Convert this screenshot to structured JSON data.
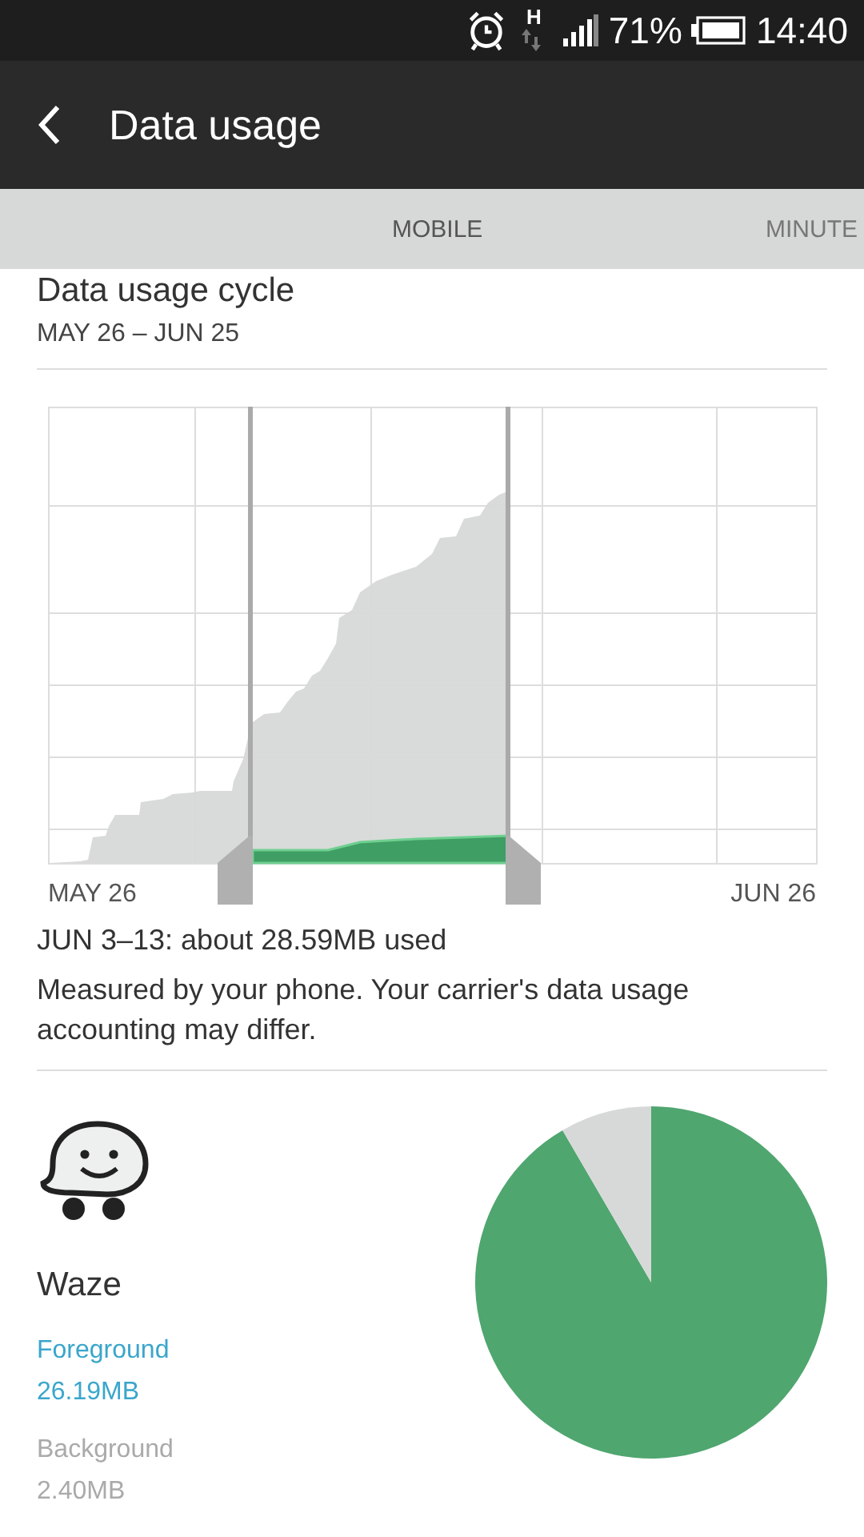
{
  "status_bar": {
    "network": "H",
    "battery": "71%",
    "time": "14:40"
  },
  "app_bar": {
    "title": "Data usage"
  },
  "tabs": [
    {
      "label": "MOBILE",
      "selected": true
    },
    {
      "label": "MINUTE",
      "selected": false
    }
  ],
  "cycle": {
    "title": "Data usage cycle",
    "range": "MAY 26 – JUN 25"
  },
  "usage_chart": {
    "start_label": "MAY 26",
    "end_label": "JUN 26"
  },
  "summary": {
    "usage": "JUN 3–13: about 28.59MB used",
    "note": "Measured by your phone. Your carrier's data usage accounting may differ."
  },
  "app": {
    "name": "Waze",
    "foreground_label": "Foreground",
    "foreground_value": "26.19MB",
    "background_label": "Background",
    "background_value": "2.40MB",
    "chart_data": {
      "type": "pie",
      "values": [
        91.6,
        8.4
      ]
    }
  }
}
